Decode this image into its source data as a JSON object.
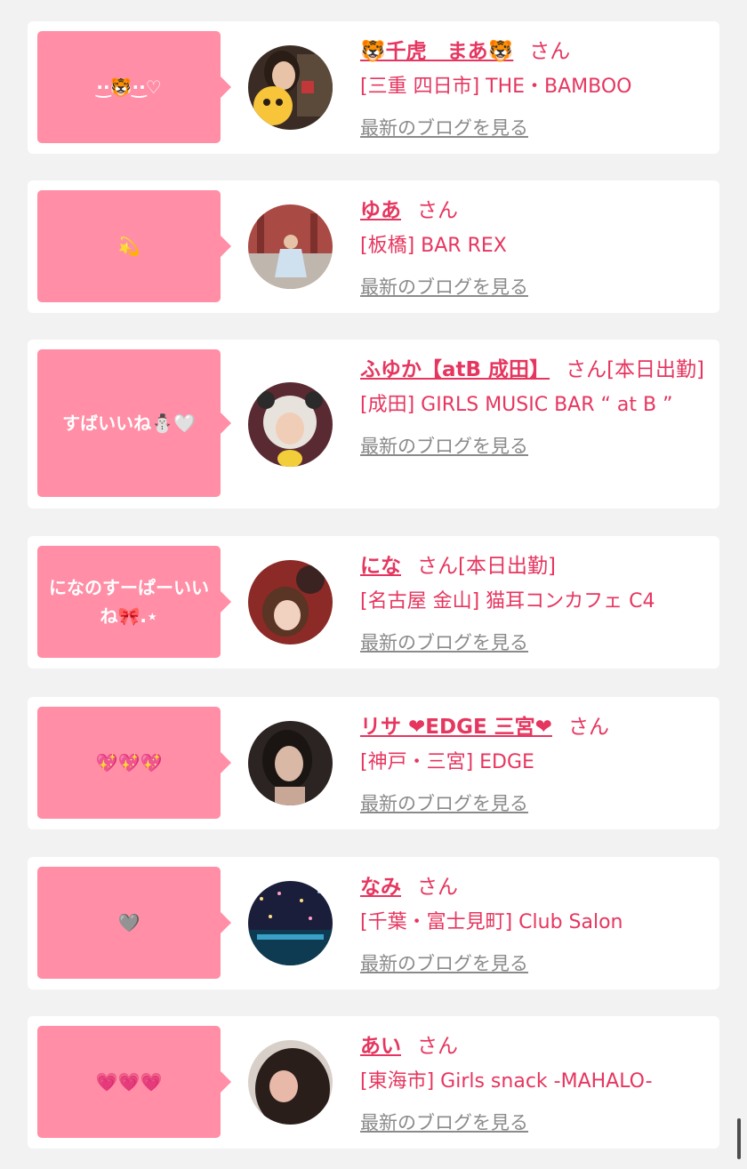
{
  "items": [
    {
      "bubble_text": "·͜·🐯·͜·♡",
      "name": "🐯千虎　まあ🐯",
      "honorific": "さん",
      "status": "",
      "shop": "[三重 四日市] THE・BAMBOO",
      "blog_link": "最新のブログを見る"
    },
    {
      "bubble_text": "💫",
      "name": "ゆあ",
      "honorific": "さん",
      "status": "",
      "shop": "[板橋] BAR REX",
      "blog_link": "最新のブログを見る"
    },
    {
      "bubble_text": "すばいいね⛄️🤍",
      "name": "ふゆか【atB 成田】",
      "honorific": "さん",
      "status": "[本日出勤]",
      "shop": "[成田] GIRLS MUSIC BAR “ at B ”",
      "blog_link": "最新のブログを見る"
    },
    {
      "bubble_text": "になのすーぱーいいね🎀.⋆",
      "name": "にな",
      "honorific": "さん",
      "status": "[本日出勤]",
      "shop": "[名古屋 金山] 猫耳コンカフェ C4",
      "blog_link": "最新のブログを見る"
    },
    {
      "bubble_text": "💖💖💖",
      "name": "リサ ❤EDGE 三宮❤",
      "honorific": "さん",
      "status": "",
      "shop": "[神戸・三宮] EDGE",
      "blog_link": "最新のブログを見る"
    },
    {
      "bubble_text": "🩶",
      "name": "なみ",
      "honorific": "さん",
      "status": "",
      "shop": "[千葉・富士見町] Club Salon",
      "blog_link": "最新のブログを見る"
    },
    {
      "bubble_text": "💗💗💗",
      "name": "あい",
      "honorific": "さん",
      "status": "",
      "shop": "[東海市] Girls snack -MAHALO-",
      "blog_link": "最新のブログを見る"
    }
  ],
  "colors": {
    "accent": "#e6365f",
    "bubble": "#ff8ea6",
    "link_gray": "#8a8a8a",
    "background": "#f2f2f2"
  }
}
